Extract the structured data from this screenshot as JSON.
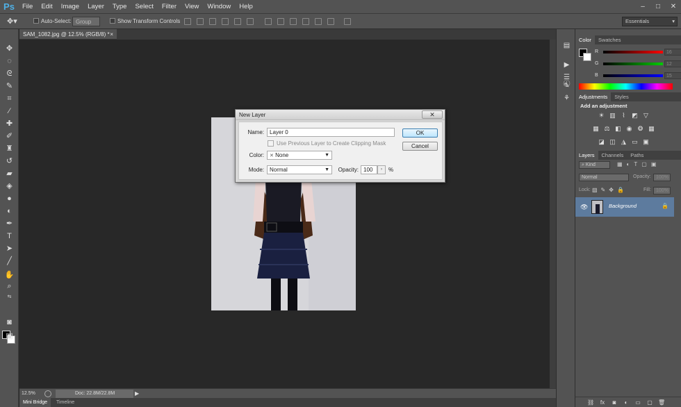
{
  "app": {
    "logo": "Ps"
  },
  "menu": [
    "File",
    "Edit",
    "Image",
    "Layer",
    "Type",
    "Select",
    "Filter",
    "View",
    "Window",
    "Help"
  ],
  "window_controls": [
    "–",
    "□",
    "✕"
  ],
  "options_bar": {
    "auto_select_label": "Auto-Select:",
    "auto_select_value": "Group",
    "transform_label": "Show Transform Controls",
    "workspace": "Essentials"
  },
  "document": {
    "tab_title": "SAM_1082.jpg @ 12.5% (RGB/8) *",
    "close": "×"
  },
  "status": {
    "zoom": "12.5%",
    "doc_size": "Doc: 22.8M/22.8M"
  },
  "bottom_tabs": [
    "Mini Bridge",
    "Timeline"
  ],
  "color_panel": {
    "tabs": [
      "Color",
      "Swatches"
    ],
    "sliders": [
      {
        "label": "R",
        "value": "16",
        "color": "#e02020"
      },
      {
        "label": "G",
        "value": "12",
        "color": "#20c020"
      },
      {
        "label": "B",
        "value": "15",
        "color": "#2030e0"
      }
    ]
  },
  "adjustments_panel": {
    "tabs": [
      "Adjustments",
      "Styles"
    ],
    "heading": "Add an adjustment"
  },
  "layers_panel": {
    "tabs": [
      "Layers",
      "Channels",
      "Paths"
    ],
    "kind": "Kind",
    "blend_mode": "Normal",
    "opacity_label": "Opacity:",
    "opacity_value": "100%",
    "lock_label": "Lock:",
    "fill_label": "Fill:",
    "fill_value": "100%",
    "layers": [
      {
        "name": "Background",
        "visible": true,
        "locked": true
      }
    ]
  },
  "dialog": {
    "title": "New Layer",
    "close": "✕",
    "name_label": "Name:",
    "name_value": "Layer 0",
    "clip_label": "Use Previous Layer to Create Clipping Mask",
    "color_label": "Color:",
    "color_value": "None",
    "color_mark": "✕",
    "mode_label": "Mode:",
    "mode_value": "Normal",
    "opacity_label": "Opacity:",
    "opacity_value": "100",
    "opacity_unit": "%",
    "ok_label": "OK",
    "cancel_label": "Cancel"
  }
}
